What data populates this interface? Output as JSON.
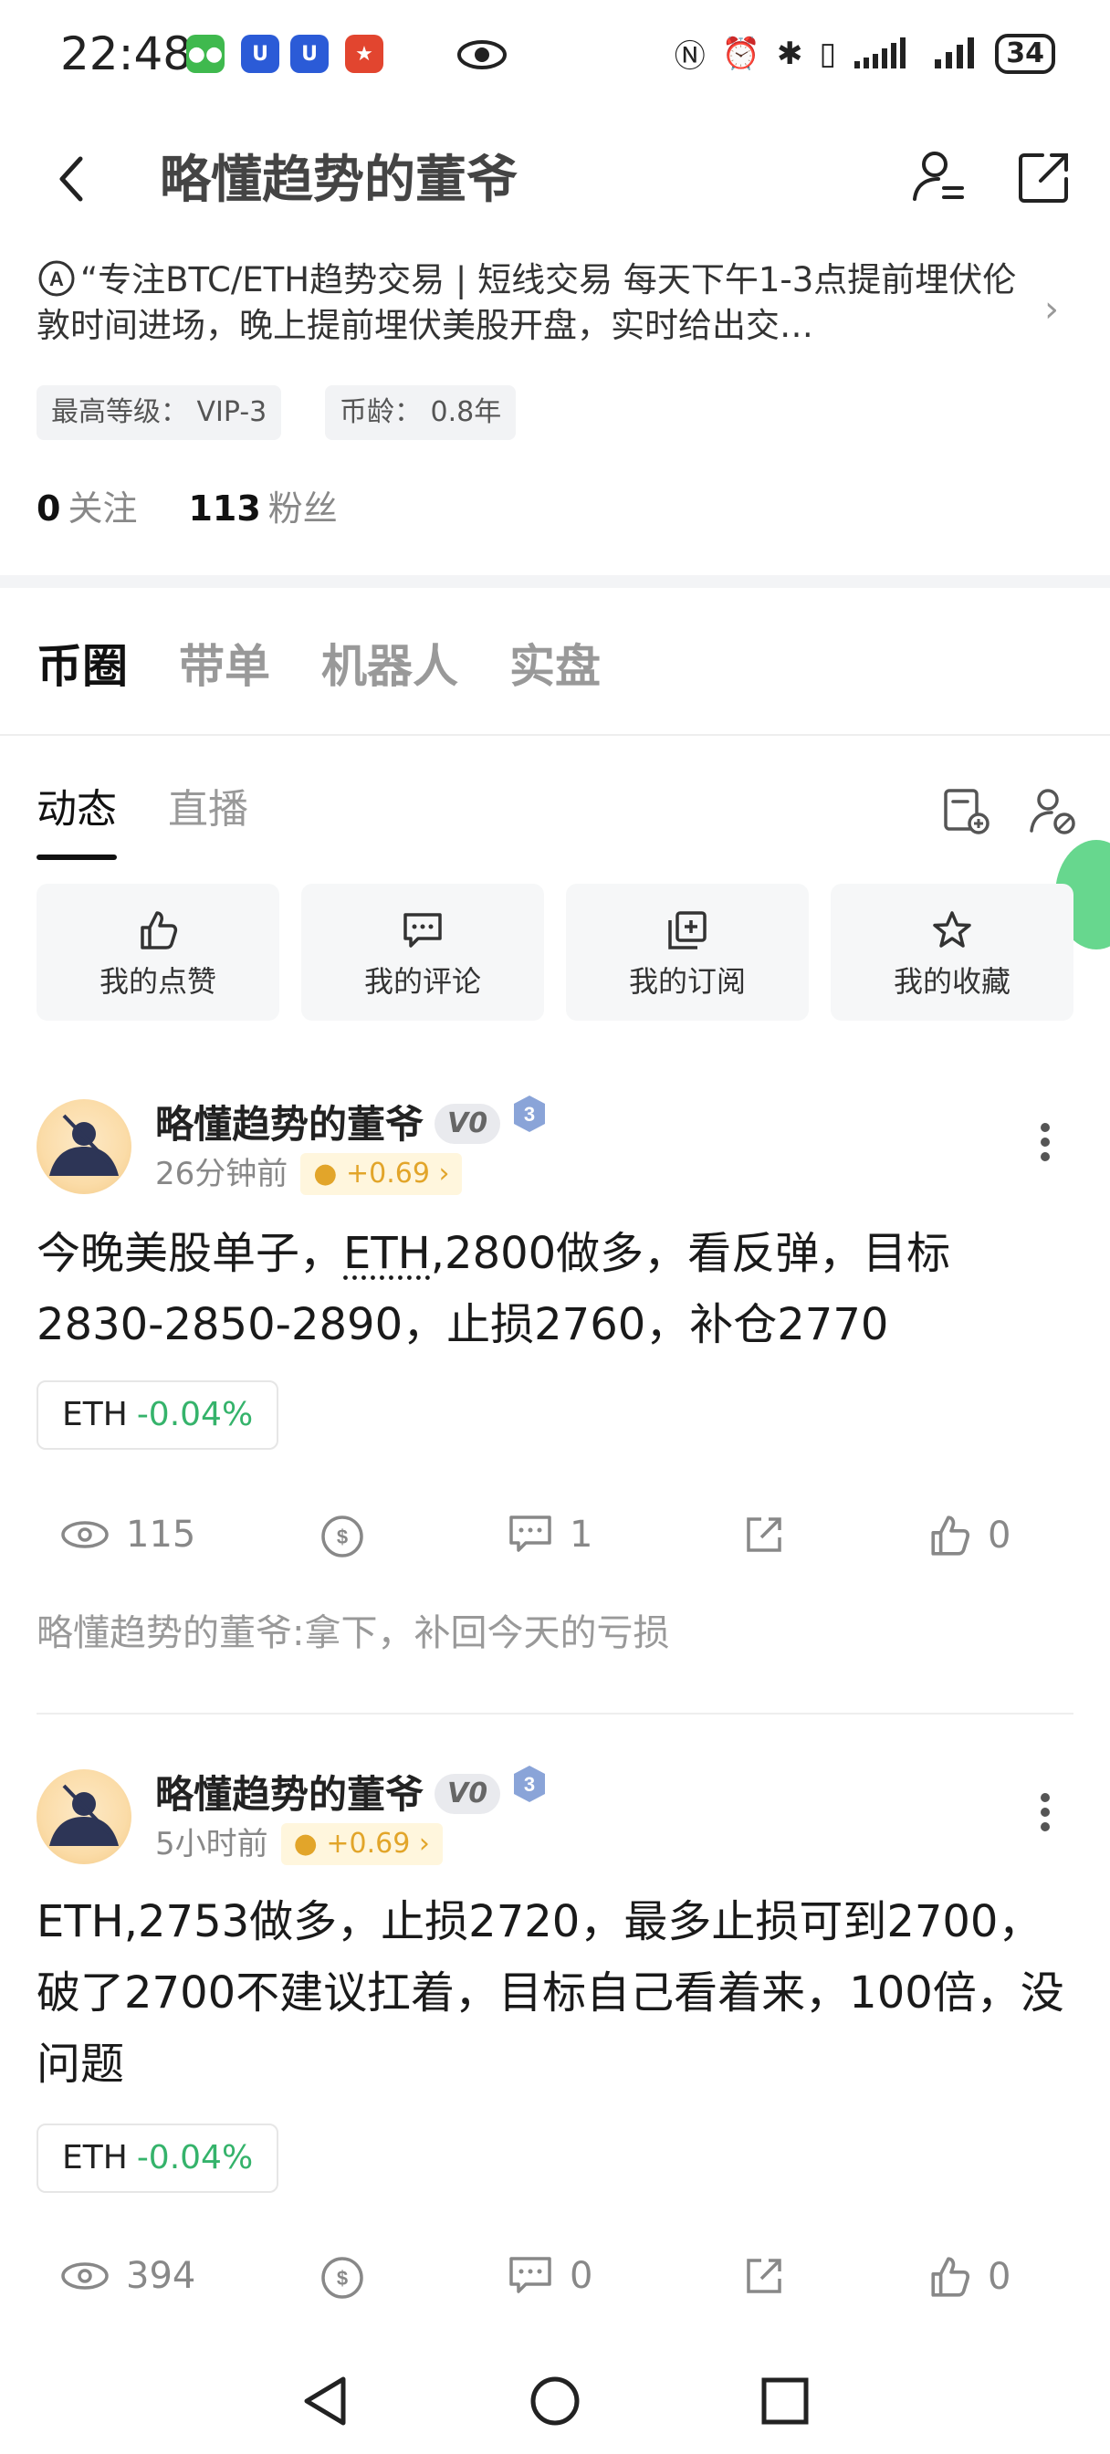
{
  "status_bar": {
    "time": "22:48",
    "battery": "34"
  },
  "header": {
    "title": "略懂趋势的董爷"
  },
  "profile": {
    "bio": "“专注BTC/ETH趋势交易 | 短线交易 每天下午1-3点提前埋伏伦敦时间进场，晚上提前埋伏美股开盘，实时给出交…",
    "tags": [
      "最高等级：  VIP-3",
      "币龄：  0.8年"
    ],
    "following_count": "0",
    "following_label": "关注",
    "followers_count": "113",
    "followers_label": "粉丝"
  },
  "main_tabs": [
    "币圈",
    "带单",
    "机器人",
    "实盘"
  ],
  "sub_tabs": [
    "动态",
    "直播"
  ],
  "quick_actions": [
    "我的点赞",
    "我的评论",
    "我的订阅",
    "我的收藏"
  ],
  "posts": [
    {
      "author": "略懂趋势的董爷",
      "vip": "V0",
      "level": "3",
      "time": "26分钟前",
      "coin": "+0.69",
      "text_pre": "今晚美股单子，",
      "text_link": "ETH",
      "text_post": ",2800做多，看反弹，目标2830-2850-2890，止损2760，补仓2770",
      "tag_symbol": "ETH",
      "tag_change": "-0.04%",
      "views": "115",
      "comments": "1",
      "likes": "0",
      "comment_preview": "略懂趋势的董爷:拿下，补回今天的亏损"
    },
    {
      "author": "略懂趋势的董爷",
      "vip": "V0",
      "level": "3",
      "time": "5小时前",
      "coin": "+0.69",
      "text": "ETH,2753做多，止损2720，最多止损可到2700，破了2700不建议扛着，目标自己看着来，100倍，没问题",
      "tag_symbol": "ETH",
      "tag_change": "-0.04%",
      "views": "394",
      "comments": "0",
      "likes": "0"
    }
  ]
}
